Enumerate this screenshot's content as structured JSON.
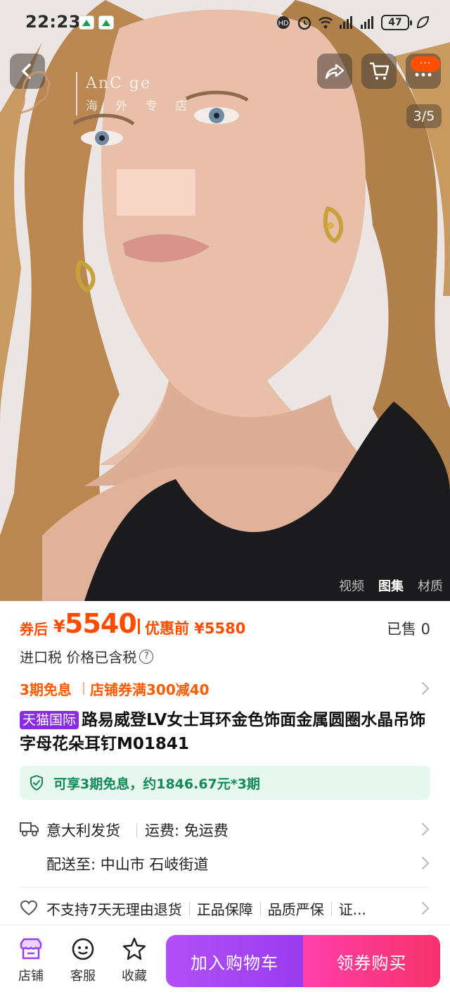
{
  "status_bar": {
    "time": "22:23",
    "battery": "47",
    "icons": [
      "app-icon",
      "app-icon",
      "hd-icon",
      "alarm-icon",
      "wifi-icon",
      "signal-icon",
      "signal-icon",
      "battery-icon",
      "leaf-icon"
    ]
  },
  "header": {
    "back_icon": "chevron-left-icon",
    "share_icon": "share-icon",
    "cart_icon": "cart-icon",
    "more_icon": "more-icon",
    "more_badge": "···"
  },
  "gallery": {
    "store_watermark_en": "AnC        ge",
    "store_watermark_cn": "海 外 专   店",
    "counter": "3/5",
    "media_tabs": [
      {
        "label": "视频",
        "active": false
      },
      {
        "label": "图集",
        "active": true
      },
      {
        "label": "材质",
        "active": false
      }
    ]
  },
  "price": {
    "after_label": "券后",
    "currency": "¥",
    "after_value": "5540",
    "before_text": "优惠前 ¥5580",
    "sold": "已售 0"
  },
  "tax": {
    "text": "进口税 价格已含税",
    "help_icon": "?"
  },
  "promo": {
    "installment": "3期免息",
    "coupon": "店铺券满300减40"
  },
  "product": {
    "badge": "天猫国际",
    "title": "路易威登LV女士耳环金色饰面金属圆圈水晶吊饰字母花朵耳钉M01841"
  },
  "installment_box": {
    "text": "可享3期免息，约1846.67元*3期"
  },
  "shipping": {
    "origin": "意大利发货",
    "fee": "运费:  免运费",
    "deliver_to": "配送至: 中山市 石岐街道"
  },
  "guarantee": {
    "items": [
      "不支持7天无理由退货",
      "正品保障",
      "品质严保",
      "证..."
    ]
  },
  "bottom_bar": {
    "store_label": "店铺",
    "service_label": "客服",
    "favorite_label": "收藏",
    "add_to_cart": "加入购物车",
    "buy_with_coupon": "领券购买"
  },
  "colors": {
    "price_orange": "#ff4c00",
    "tmall_purple": "#8a2be2",
    "install_green": "#138a57",
    "cart_purple": "#a445f3",
    "buy_pink": "#f5326b"
  }
}
